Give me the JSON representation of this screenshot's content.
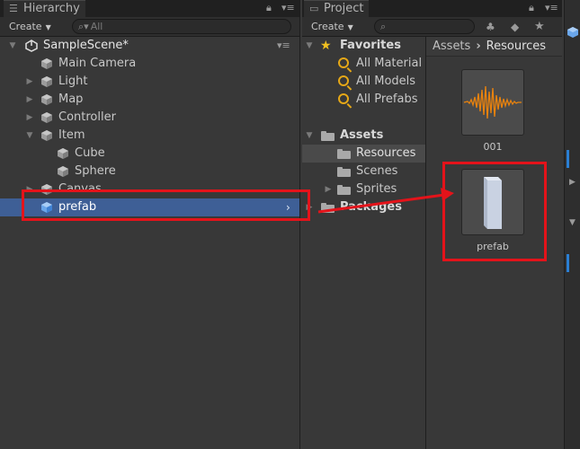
{
  "hierarchy": {
    "tab_label": "Hierarchy",
    "create_label": "Create",
    "search_placeholder": "All",
    "scene_name": "SampleScene*",
    "items": [
      {
        "label": "Main Camera"
      },
      {
        "label": "Light"
      },
      {
        "label": "Map"
      },
      {
        "label": "Controller"
      },
      {
        "label": "Item"
      },
      {
        "label": "Cube"
      },
      {
        "label": "Sphere"
      },
      {
        "label": "Canvas"
      },
      {
        "label": "prefab"
      }
    ]
  },
  "project": {
    "tab_label": "Project",
    "create_label": "Create",
    "favorites_label": "Favorites",
    "favorites": [
      {
        "label": "All Material"
      },
      {
        "label": "All Models"
      },
      {
        "label": "All Prefabs"
      }
    ],
    "assets_label": "Assets",
    "asset_folders": [
      {
        "label": "Resources"
      },
      {
        "label": "Scenes"
      },
      {
        "label": "Sprites"
      }
    ],
    "packages_label": "Packages",
    "breadcrumb": {
      "root": "Assets",
      "current": "Resources"
    },
    "assets_grid": [
      {
        "label": "001",
        "icon": "audio-waveform-icon"
      },
      {
        "label": "prefab",
        "icon": "prefab-preview-icon"
      }
    ]
  },
  "colors": {
    "selection": "#3e5f96",
    "annotation": "#e4131a",
    "favorite_star": "#e6a817",
    "waveform": "#e8820e"
  }
}
